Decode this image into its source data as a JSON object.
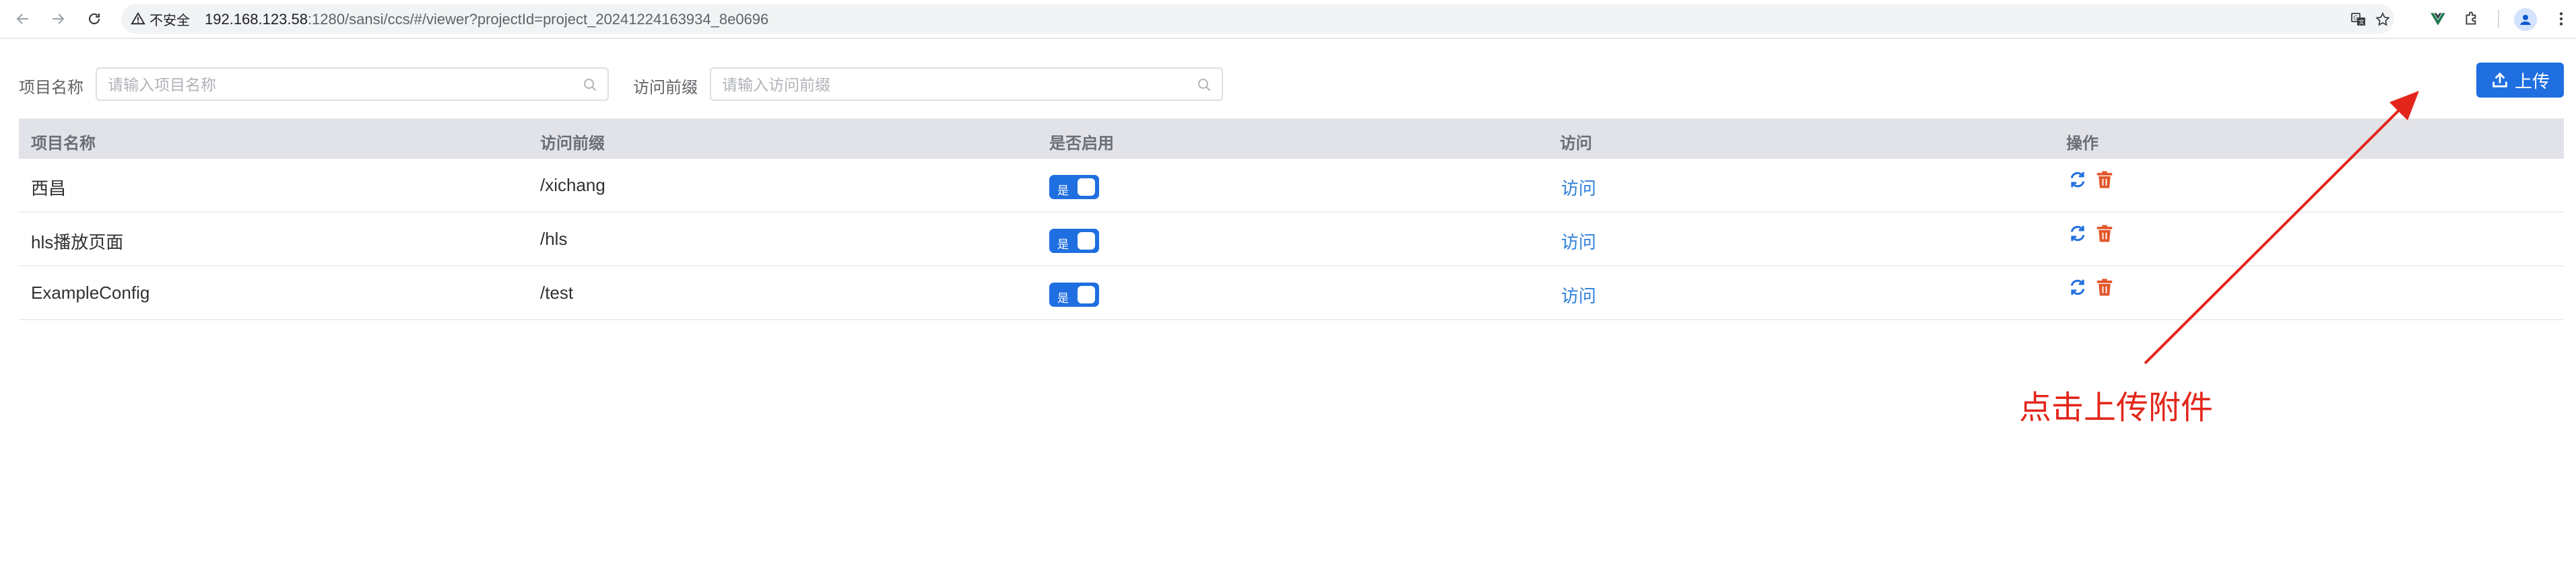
{
  "browser": {
    "security_label": "不安全",
    "url_host": "192.168.123.58",
    "url_rest": ":1280/sansi/ccs/#/viewer?projectId=project_20241224163934_8e0696"
  },
  "filters": {
    "project_name_label": "项目名称",
    "project_name_placeholder": "请输入项目名称",
    "prefix_label": "访问前缀",
    "prefix_placeholder": "请输入访问前缀"
  },
  "upload_label": "上传",
  "table": {
    "headers": [
      "项目名称",
      "访问前缀",
      "是否启用",
      "访问",
      "操作"
    ],
    "rows": [
      {
        "name": "西昌",
        "prefix": "/xichang",
        "enabled": "是",
        "visit": "访问"
      },
      {
        "name": "hls播放页面",
        "prefix": "/hls",
        "enabled": "是",
        "visit": "访问"
      },
      {
        "name": "ExampleConfig",
        "prefix": "/test",
        "enabled": "是",
        "visit": "访问"
      }
    ]
  },
  "annotation": {
    "text": "点击上传附件",
    "color": "#e3261b"
  },
  "colors": {
    "primary": "#1f6fe0",
    "link": "#2e7fd8",
    "delete": "#e2572b",
    "header_bg": "#e2e3e8"
  },
  "icons": [
    "back-icon",
    "forward-icon",
    "reload-icon",
    "warning-icon",
    "translate-icon",
    "star-icon",
    "vue-extension-icon",
    "extensions-icon",
    "profile-icon",
    "menu-icon",
    "search-icon",
    "upload-icon",
    "refresh-icon",
    "trash-icon"
  ]
}
